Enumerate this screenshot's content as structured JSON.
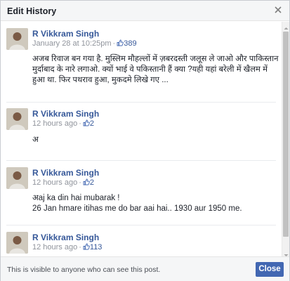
{
  "dialog": {
    "title": "Edit History",
    "footer_note": "This is visible to anyone who can see this post.",
    "close_label": "Close"
  },
  "entries": [
    {
      "author": "R Vikkram Singh",
      "time": "January 28 at 10:25pm",
      "reactions": "389",
      "text": "अजब रिवाज बन गया है. मुस्लिम मौहल्लों में ज़बरदस्ती जलूस ले जाओ और पाकिस्तान मुर्दाबाद के नारे लगाओ. क्यों भाई वे पकिस्तानी हैं क्या ?यही यहां बरेली में खैलम में हुआ था. फिर पथराव हुआ, मुकदमे लिखे गए ..."
    },
    {
      "author": "R Vikkram Singh",
      "time": "12 hours ago",
      "reactions": "2",
      "text": "अ"
    },
    {
      "author": "R Vikkram Singh",
      "time": "12 hours ago",
      "reactions": "2",
      "text_line1": "अaj ka din hai mubarak !",
      "text_line2": "26 Jan hmare itihas me do bar aai hai.. 1930 aur 1950 me."
    },
    {
      "author": "R Vikkram Singh",
      "time": "12 hours ago",
      "reactions": "113"
    }
  ],
  "icons": {
    "close": "close-icon",
    "like": "thumbs-up-icon",
    "avatar": "avatar"
  },
  "colors": {
    "link": "#365899",
    "button": "#4267b2",
    "header_bg": "#f5f6f7"
  }
}
